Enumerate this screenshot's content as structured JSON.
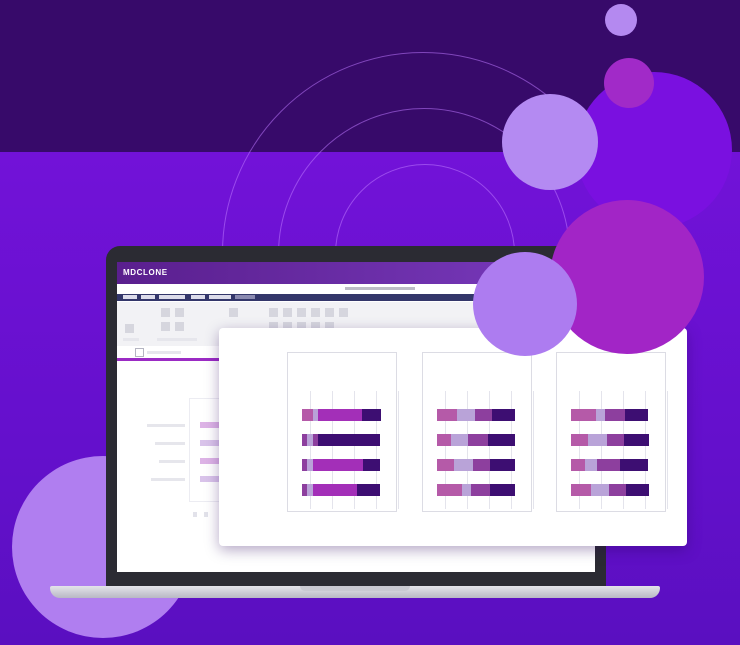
{
  "app": {
    "brand_name": "MDCLONE"
  },
  "colors": {
    "top_band": "#370a6a",
    "background": "#6a10d0",
    "accent_purple": "#9b2bc4",
    "seg_magenta": "#a32fb8",
    "seg_pink": "#b55aa8",
    "seg_lavender": "#b9a3d8",
    "seg_plum": "#8d3f9e",
    "seg_dark": "#3d0e72"
  },
  "charts": [
    {
      "rows": [
        [
          [
            "#b55aa8",
            0.14
          ],
          [
            "#b9a3d8",
            0.06
          ],
          [
            "#a32fb8",
            0.56
          ],
          [
            "#3d0e72",
            0.24
          ]
        ],
        [
          [
            "#8d3f9e",
            0.06
          ],
          [
            "#b9a3d8",
            0.08
          ],
          [
            "#8d3f9e",
            0.06
          ],
          [
            "#3d0e72",
            0.8
          ]
        ],
        [
          [
            "#8d3f9e",
            0.06
          ],
          [
            "#b9a3d8",
            0.08
          ],
          [
            "#a32fb8",
            0.64
          ],
          [
            "#3d0e72",
            0.22
          ]
        ],
        [
          [
            "#8d3f9e",
            0.06
          ],
          [
            "#b9a3d8",
            0.08
          ],
          [
            "#a32fb8",
            0.56
          ],
          [
            "#3d0e72",
            0.3
          ]
        ]
      ]
    },
    {
      "rows": [
        [
          [
            "#b55aa8",
            0.25
          ],
          [
            "#b9a3d8",
            0.23
          ],
          [
            "#8d3f9e",
            0.22
          ],
          [
            "#3d0e72",
            0.3
          ]
        ],
        [
          [
            "#b55aa8",
            0.18
          ],
          [
            "#b9a3d8",
            0.22
          ],
          [
            "#8d3f9e",
            0.25
          ],
          [
            "#3d0e72",
            0.35
          ]
        ],
        [
          [
            "#b55aa8",
            0.22
          ],
          [
            "#b9a3d8",
            0.24
          ],
          [
            "#8d3f9e",
            0.22
          ],
          [
            "#3d0e72",
            0.32
          ]
        ],
        [
          [
            "#b55aa8",
            0.32
          ],
          [
            "#b9a3d8",
            0.12
          ],
          [
            "#8d3f9e",
            0.24
          ],
          [
            "#3d0e72",
            0.32
          ]
        ]
      ]
    },
    {
      "rows": [
        [
          [
            "#b55aa8",
            0.32
          ],
          [
            "#b9a3d8",
            0.12
          ],
          [
            "#8d3f9e",
            0.26
          ],
          [
            "#3d0e72",
            0.3
          ]
        ],
        [
          [
            "#b55aa8",
            0.22
          ],
          [
            "#b9a3d8",
            0.24
          ],
          [
            "#8d3f9e",
            0.22
          ],
          [
            "#3d0e72",
            0.32
          ]
        ],
        [
          [
            "#b55aa8",
            0.18
          ],
          [
            "#b9a3d8",
            0.16
          ],
          [
            "#8d3f9e",
            0.3
          ],
          [
            "#3d0e72",
            0.36
          ]
        ],
        [
          [
            "#b55aa8",
            0.25
          ],
          [
            "#b9a3d8",
            0.23
          ],
          [
            "#8d3f9e",
            0.22
          ],
          [
            "#3d0e72",
            0.3
          ]
        ]
      ]
    }
  ]
}
